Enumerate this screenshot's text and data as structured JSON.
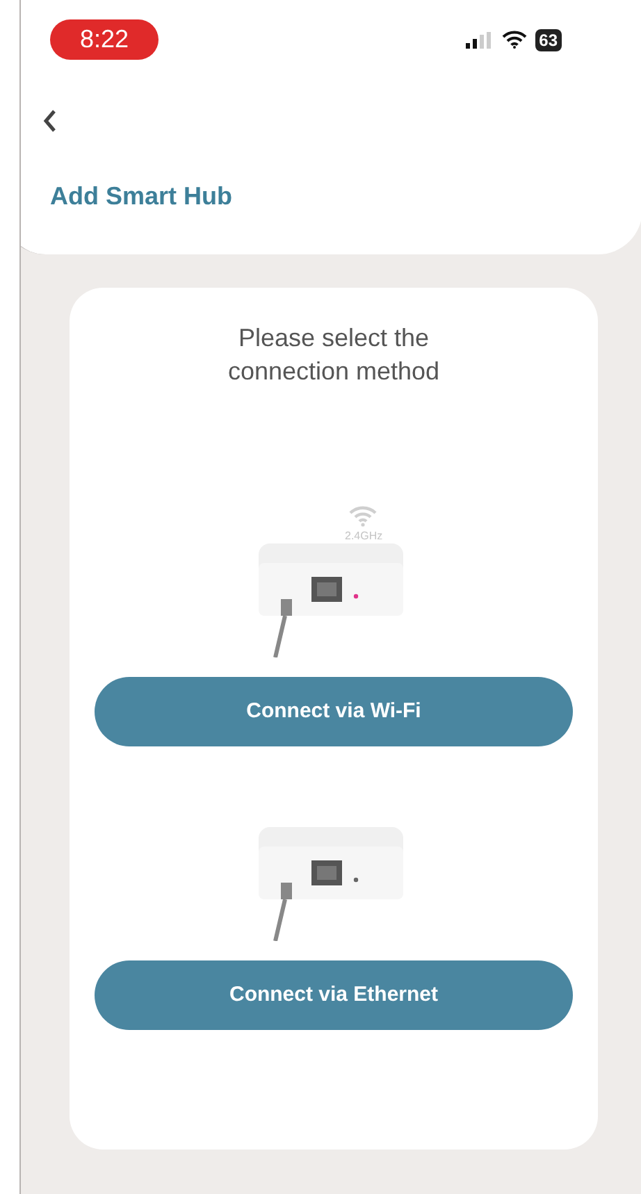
{
  "status_bar": {
    "time": "8:22",
    "battery": "63"
  },
  "header": {
    "title": "Add Smart Hub"
  },
  "card": {
    "prompt": "Please select the connection method",
    "options": [
      {
        "kind": "wifi",
        "band": "2.4GHz",
        "button": "Connect via Wi-Fi"
      },
      {
        "kind": "ethernet",
        "button": "Connect via Ethernet"
      }
    ]
  }
}
